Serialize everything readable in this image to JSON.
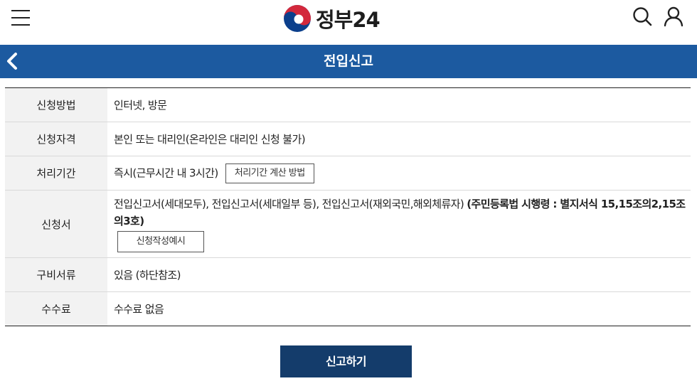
{
  "header": {
    "logo_text": "정부24",
    "menu_icon": "hamburger-menu-icon",
    "search_icon": "search-icon",
    "user_icon": "user-icon"
  },
  "titlebar": {
    "title": "전입신고",
    "back_icon": "chevron-left-icon",
    "bg_color": "#1c5aa0"
  },
  "rows": [
    {
      "label": "신청방법",
      "value": "인터넷, 방문"
    },
    {
      "label": "신청자격",
      "value": "본인 또는 대리인(온라인은 대리인 신청 불가)"
    },
    {
      "label": "처리기간",
      "value": "즉시(근무시간 내 3시간)",
      "button": "처리기간 계산 방법"
    },
    {
      "label": "신청서",
      "value": "전입신고서(세대모두), 전입신고서(세대일부 등), 전입신고서(재외국민,해외체류자) ",
      "value_bold": "(주민등록법 시행령 : 별지서식 15,15조의2,15조의3호)",
      "button": "신청작성예시"
    },
    {
      "label": "구비서류",
      "value": "있음 (하단참조)"
    },
    {
      "label": "수수료",
      "value": "수수료 없음"
    }
  ],
  "submit": {
    "label": "신고하기",
    "bg_color": "#143c6b"
  }
}
